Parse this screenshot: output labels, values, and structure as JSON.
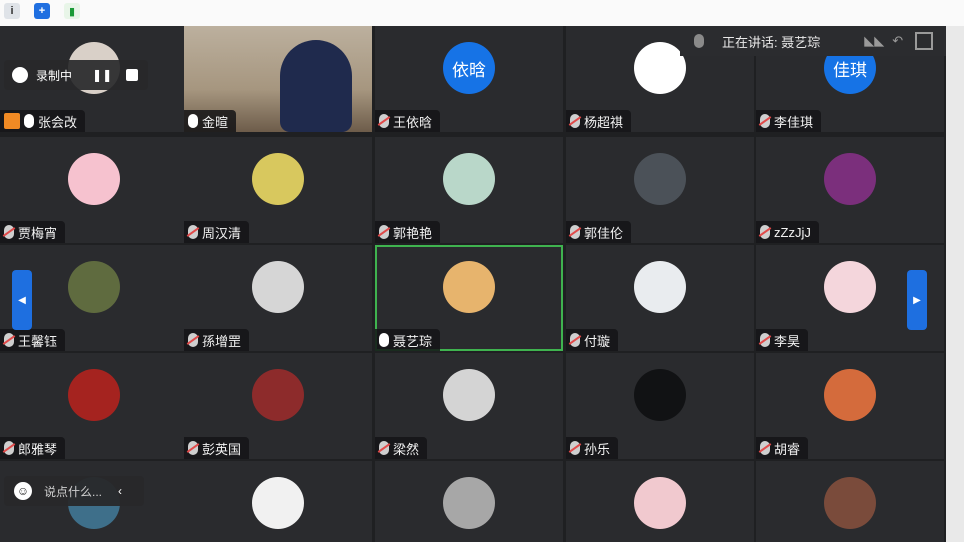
{
  "toolbar": {
    "icons": [
      "info-icon",
      "shield-icon",
      "signal-icon"
    ]
  },
  "speaker": {
    "label": "正在讲话: 聂艺琮"
  },
  "recording": {
    "label": "录制中"
  },
  "chat": {
    "placeholder": "说点什么..."
  },
  "participants": [
    {
      "name": "张会改",
      "avatar_color": "#d9d0c8",
      "avatar_text": "",
      "mic": "on",
      "host": true
    },
    {
      "name": "金暄",
      "avatar_color": "#c9b9a3",
      "avatar_text": "",
      "mic": "on",
      "video": true
    },
    {
      "name": "王依晗",
      "avatar_color": "#1673e6",
      "avatar_text": "依晗",
      "mic": "muted"
    },
    {
      "name": "杨超祺",
      "avatar_color": "#ffffff",
      "avatar_text": "",
      "mic": "muted"
    },
    {
      "name": "李佳琪",
      "avatar_color": "#1673e6",
      "avatar_text": "佳琪",
      "mic": "muted"
    },
    {
      "name": "贾梅宵",
      "avatar_color": "#f6c2cf",
      "avatar_text": "",
      "mic": "muted"
    },
    {
      "name": "周汉清",
      "avatar_color": "#d8c85e",
      "avatar_text": "",
      "mic": "muted"
    },
    {
      "name": "郭艳艳",
      "avatar_color": "#b9d7c9",
      "avatar_text": "",
      "mic": "muted"
    },
    {
      "name": "郭佳伦",
      "avatar_color": "#4b5158",
      "avatar_text": "",
      "mic": "muted"
    },
    {
      "name": "zZzJjJ",
      "avatar_color": "#7b2f7c",
      "avatar_text": "",
      "mic": "muted"
    },
    {
      "name": "王馨钰",
      "avatar_color": "#5f6b3f",
      "avatar_text": "",
      "mic": "muted"
    },
    {
      "name": "孫增罡",
      "avatar_color": "#d6d6d6",
      "avatar_text": "",
      "mic": "muted"
    },
    {
      "name": "聂艺琮",
      "avatar_color": "#e7b46d",
      "avatar_text": "",
      "mic": "on",
      "active": true
    },
    {
      "name": "付璇",
      "avatar_color": "#e9ecef",
      "avatar_text": "",
      "mic": "muted"
    },
    {
      "name": "李昊",
      "avatar_color": "#f4d6dc",
      "avatar_text": "",
      "mic": "muted"
    },
    {
      "name": "郎雅琴",
      "avatar_color": "#a5231f",
      "avatar_text": "",
      "mic": "muted"
    },
    {
      "name": "彭英国",
      "avatar_color": "#8d2b2b",
      "avatar_text": "",
      "mic": "muted"
    },
    {
      "name": "梁然",
      "avatar_color": "#d4d4d4",
      "avatar_text": "",
      "mic": "muted"
    },
    {
      "name": "孙乐",
      "avatar_color": "#111214",
      "avatar_text": "",
      "mic": "muted"
    },
    {
      "name": "胡睿",
      "avatar_color": "#d46b3c",
      "avatar_text": "",
      "mic": "muted"
    },
    {
      "name": "",
      "avatar_color": "#3e6f8a",
      "avatar_text": "",
      "mic": "none"
    },
    {
      "name": "",
      "avatar_color": "#f1f1f1",
      "avatar_text": "",
      "mic": "none"
    },
    {
      "name": "",
      "avatar_color": "#a7a7a7",
      "avatar_text": "",
      "mic": "none"
    },
    {
      "name": "",
      "avatar_color": "#f1c9cf",
      "avatar_text": "",
      "mic": "none"
    },
    {
      "name": "",
      "avatar_color": "#7a4b3b",
      "avatar_text": "",
      "mic": "none"
    }
  ]
}
